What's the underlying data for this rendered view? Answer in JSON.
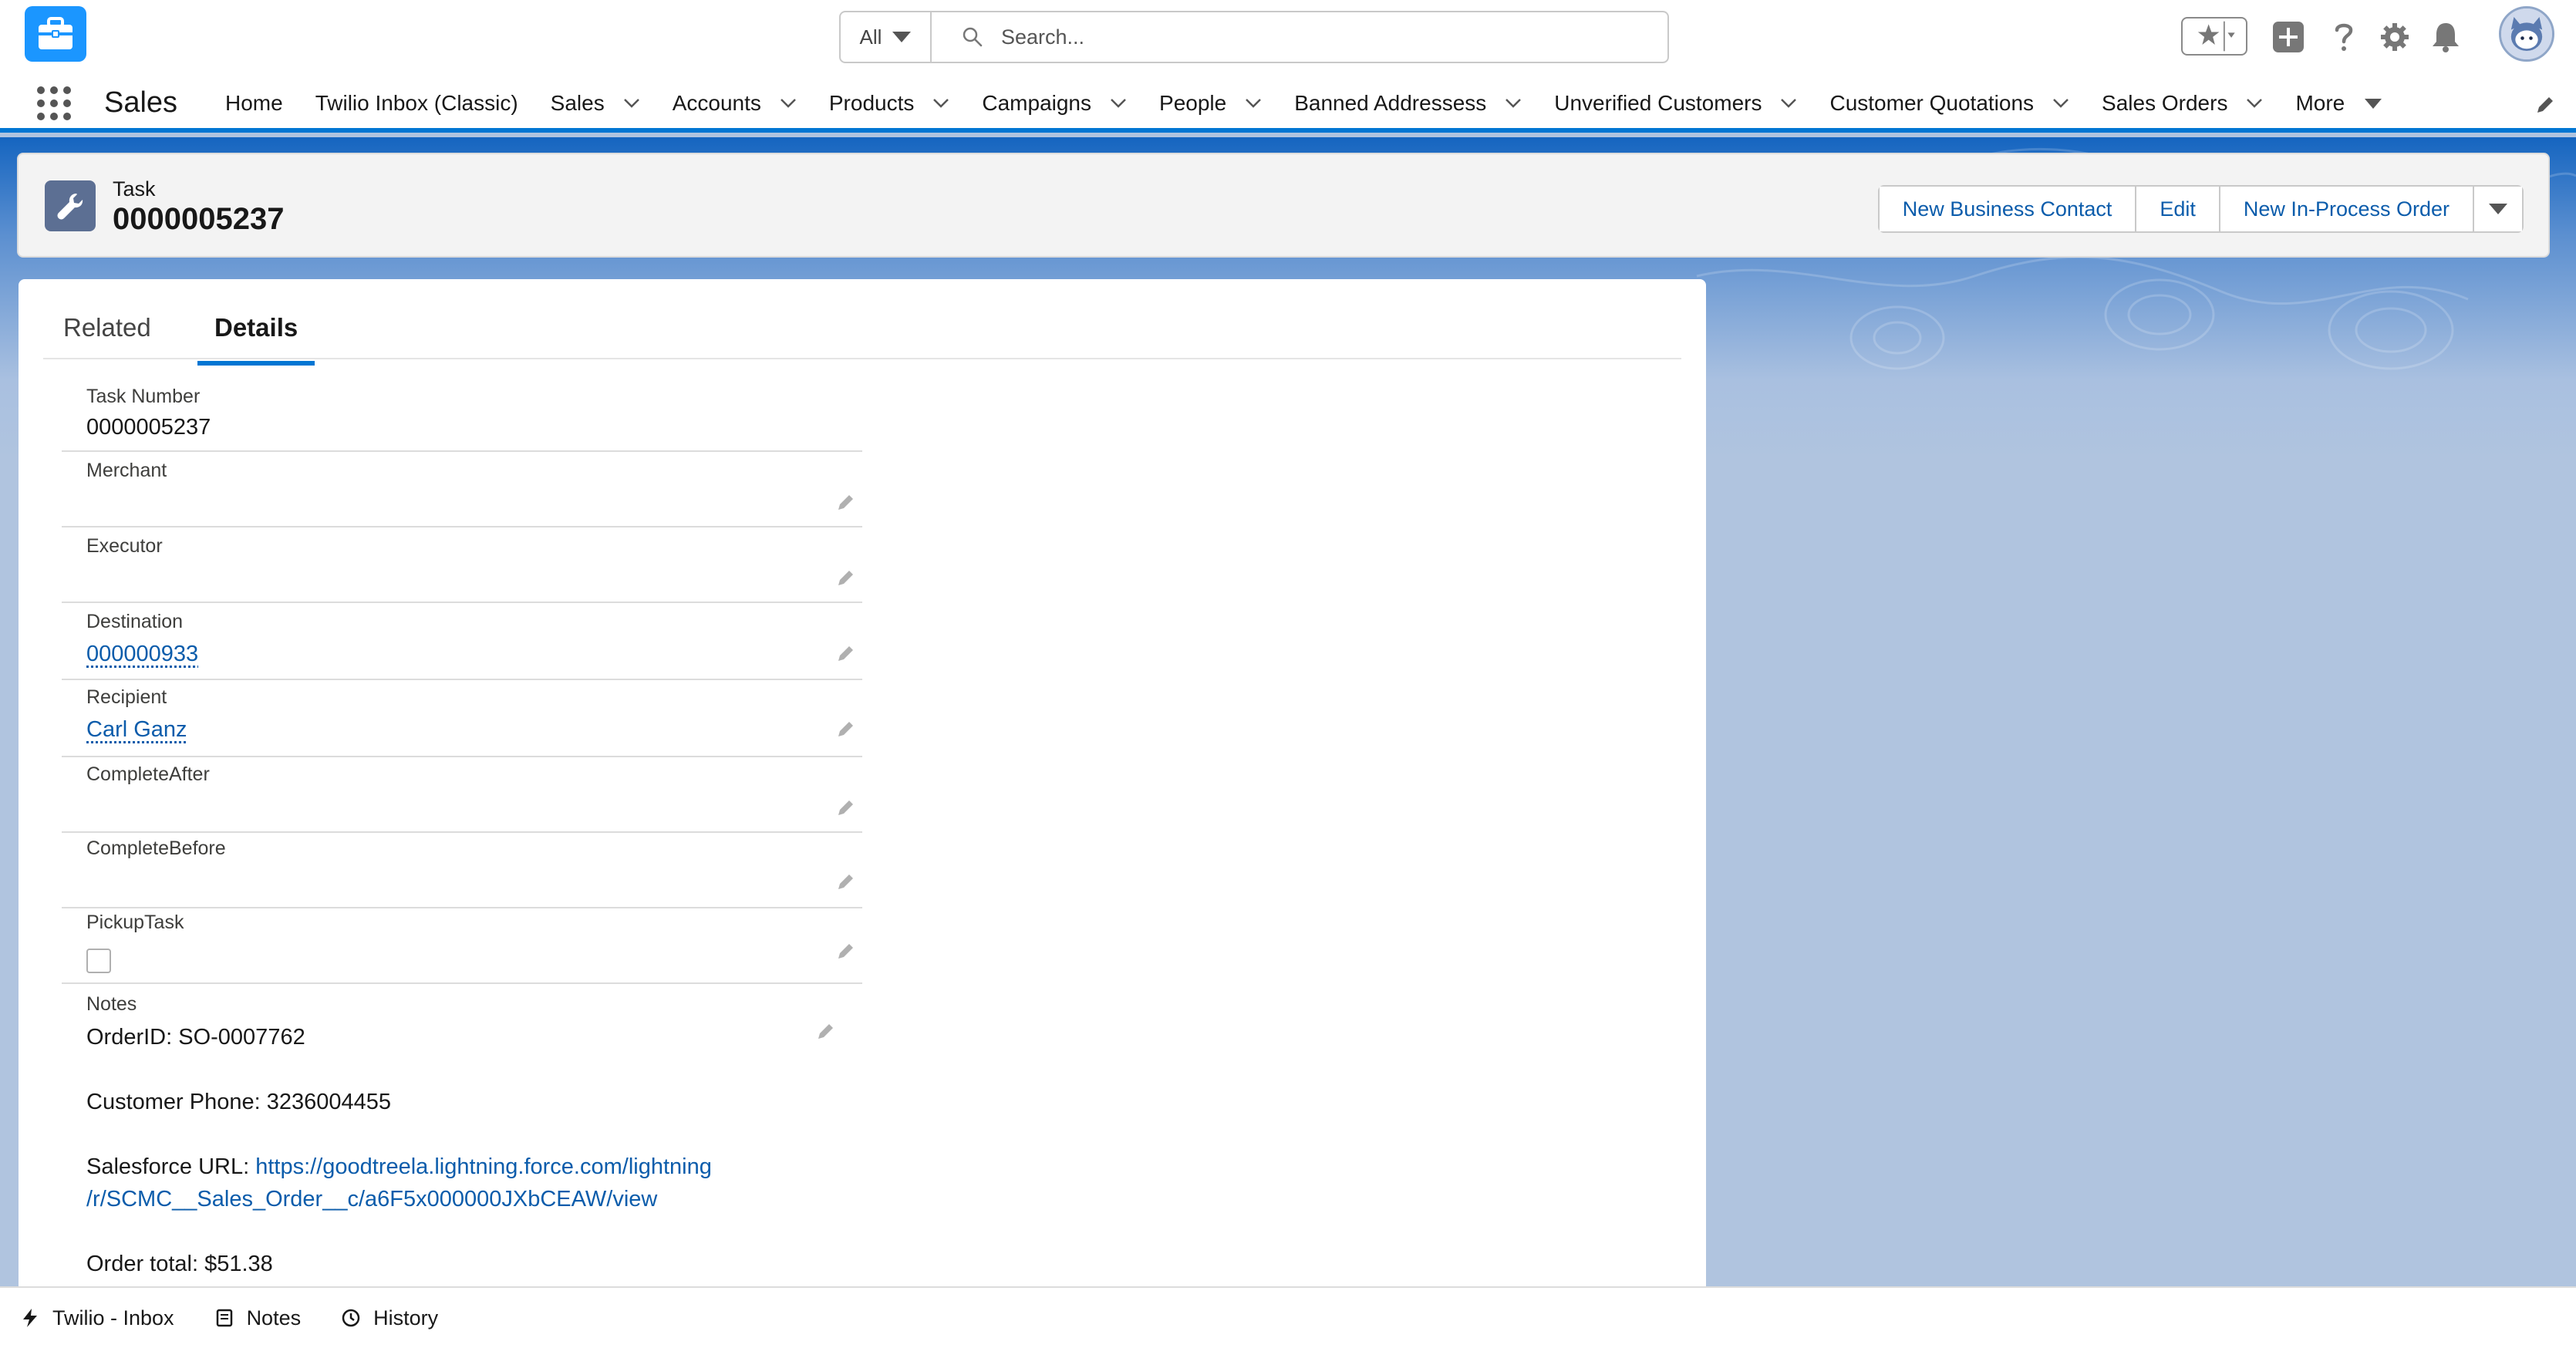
{
  "global_header": {
    "search_scope": "All",
    "search_placeholder": "Search..."
  },
  "nav": {
    "app_name": "Sales",
    "items": [
      {
        "label": "Home",
        "has_menu": false
      },
      {
        "label": "Twilio Inbox (Classic)",
        "has_menu": false
      },
      {
        "label": "Sales",
        "has_menu": true
      },
      {
        "label": "Accounts",
        "has_menu": true
      },
      {
        "label": "Products",
        "has_menu": true
      },
      {
        "label": "Campaigns",
        "has_menu": true
      },
      {
        "label": "People",
        "has_menu": true
      },
      {
        "label": "Banned Addressess",
        "has_menu": true
      },
      {
        "label": "Unverified Customers",
        "has_menu": true
      },
      {
        "label": "Customer Quotations",
        "has_menu": true
      },
      {
        "label": "Sales Orders",
        "has_menu": true
      }
    ],
    "more_label": "More"
  },
  "record": {
    "type": "Task",
    "title": "0000005237",
    "actions": [
      "New Business Contact",
      "Edit",
      "New In-Process Order"
    ]
  },
  "tabs": {
    "related": "Related",
    "details": "Details",
    "active": "Details"
  },
  "fields": {
    "task_number": {
      "label": "Task Number",
      "value": "0000005237"
    },
    "merchant": {
      "label": "Merchant",
      "value": ""
    },
    "executor": {
      "label": "Executor",
      "value": ""
    },
    "destination": {
      "label": "Destination",
      "value": "000000933"
    },
    "recipient": {
      "label": "Recipient",
      "value": "Carl Ganz"
    },
    "complete_after": {
      "label": "CompleteAfter",
      "value": ""
    },
    "complete_before": {
      "label": "CompleteBefore",
      "value": ""
    },
    "pickup_task": {
      "label": "PickupTask",
      "checked": false
    },
    "notes": {
      "label": "Notes",
      "order_id": "OrderID: SO-0007762",
      "customer_phone": "Customer Phone: 3236004455",
      "url_prefix": "Salesforce URL: ",
      "url_line1": "https://goodtreela.lightning.force.com/lightning",
      "url_line2": "/r/SCMC__Sales_Order__c/a6F5x000000JXbCEAW/view",
      "order_total": "Order total: $51.38"
    }
  },
  "utility_bar": {
    "items": [
      "Twilio - Inbox",
      "Notes",
      "History"
    ]
  },
  "colors": {
    "brand": "#0176d3",
    "link": "#0b5cab",
    "record_icon": "#5c6f93",
    "app_logo": "#1b96ff"
  }
}
